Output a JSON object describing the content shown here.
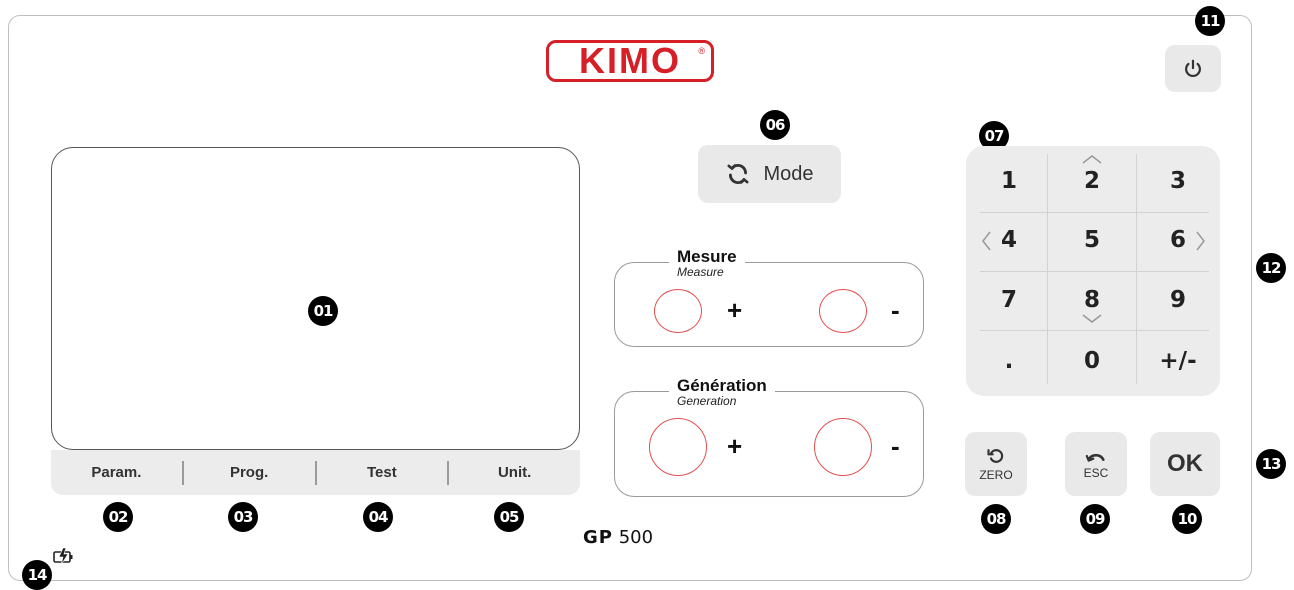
{
  "brand": {
    "logo": "KIMO",
    "mark": "®",
    "model": "GP",
    "model_number": "500",
    "accent": "#d62027"
  },
  "screen_callout": "01",
  "function_keys": [
    {
      "label": "Param.",
      "callout": "02"
    },
    {
      "label": "Prog.",
      "callout": "03"
    },
    {
      "label": "Test",
      "callout": "04"
    },
    {
      "label": "Unit.",
      "callout": "05"
    }
  ],
  "mode_button": {
    "label": "Mode",
    "callout": "06",
    "icon": "refresh-icon"
  },
  "measure_group": {
    "title": "Mesure",
    "subtitle": "Measure",
    "plus": "+",
    "minus": "-"
  },
  "generation_group": {
    "title": "Génération",
    "subtitle": "Generation",
    "plus": "+",
    "minus": "-"
  },
  "keypad": {
    "callout": "07",
    "side_callout": "12",
    "keys": [
      "1",
      "2",
      "3",
      "4",
      "5",
      "6",
      "7",
      "8",
      "9",
      ".",
      "0",
      "+/-"
    ]
  },
  "zero_button": {
    "label": "ZERO",
    "callout": "08",
    "icon": "undo-icon"
  },
  "esc_button": {
    "label": "ESC",
    "callout": "09",
    "icon": "back-arrow-icon"
  },
  "ok_button": {
    "label": "OK",
    "callout": "10",
    "side_callout": "13"
  },
  "power_button": {
    "callout": "11",
    "icon": "power-icon"
  },
  "battery": {
    "callout": "14",
    "icon": "battery-charging-icon"
  }
}
